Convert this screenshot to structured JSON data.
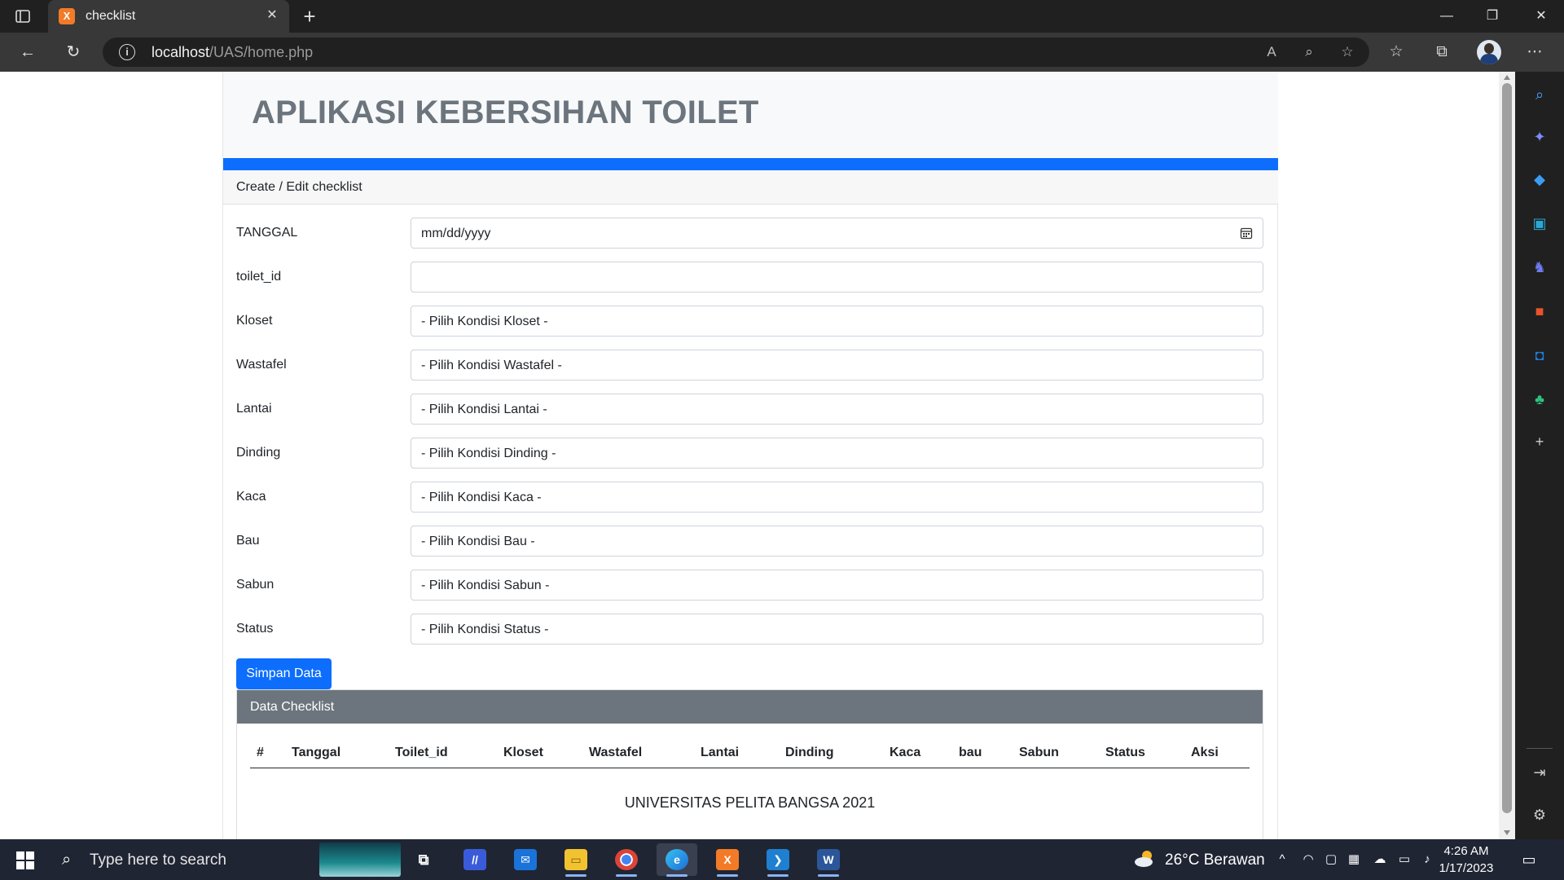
{
  "browser": {
    "tab_title": "checklist",
    "url_host": "localhost",
    "url_path": "/UAS/home.php"
  },
  "page": {
    "app_title": "APLIKASI KEBERSIHAN TOILET",
    "form_header": "Create / Edit checklist",
    "fields": [
      {
        "label": "TANGGAL",
        "value": "mm/dd/yyyy"
      },
      {
        "label": "toilet_id",
        "value": ""
      },
      {
        "label": "Kloset",
        "value": "- Pilih Kondisi Kloset -"
      },
      {
        "label": "Wastafel",
        "value": "- Pilih Kondisi Wastafel -"
      },
      {
        "label": "Lantai",
        "value": "- Pilih Kondisi Lantai -"
      },
      {
        "label": "Dinding",
        "value": "- Pilih Kondisi Dinding -"
      },
      {
        "label": "Kaca",
        "value": "- Pilih Kondisi Kaca -"
      },
      {
        "label": "Bau",
        "value": "- Pilih Kondisi Bau -"
      },
      {
        "label": "Sabun",
        "value": "- Pilih Kondisi Sabun -"
      },
      {
        "label": "Status",
        "value": "- Pilih Kondisi Status -"
      }
    ],
    "submit_label": "Simpan Data",
    "table_title": "Data Checklist",
    "table_columns": [
      "#",
      "Tanggal",
      "Toilet_id",
      "Kloset",
      "Wastafel",
      "Lantai",
      "Dinding",
      "Kaca",
      "bau",
      "Sabun",
      "Status",
      "Aksi"
    ],
    "footer": "UNIVERSITAS PELITA BANGSA 2021"
  },
  "taskbar": {
    "search_placeholder": "Type here to search",
    "weather": "26°C  Berawan",
    "time": "4:26 AM",
    "date": "1/17/2023"
  },
  "colors": {
    "primary": "#0d6efd",
    "secondary": "#6c757d",
    "jumbotron_bg": "#f8f9fa"
  }
}
